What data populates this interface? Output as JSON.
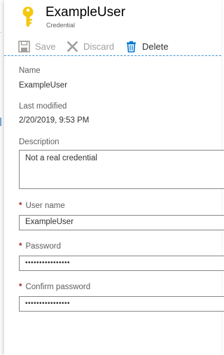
{
  "header": {
    "title": "ExampleUser",
    "subtitle": "Credential",
    "icon": "key-icon",
    "icon_color": "#f2c811"
  },
  "toolbar": {
    "save_label": "Save",
    "discard_label": "Discard",
    "delete_label": "Delete",
    "accent": "#0078d4"
  },
  "details": {
    "name_label": "Name",
    "name_value": "ExampleUser",
    "modified_label": "Last modified",
    "modified_value": "2/20/2019, 9:53 PM"
  },
  "form": {
    "description_label": "Description",
    "description_value": "Not a real credential",
    "username_label": "User name",
    "username_value": "ExampleUser",
    "password_label": "Password",
    "password_value": "••••••••••••••••",
    "confirm_label": "Confirm password",
    "confirm_value": "••••••••••••••••",
    "required_marker": "*"
  }
}
